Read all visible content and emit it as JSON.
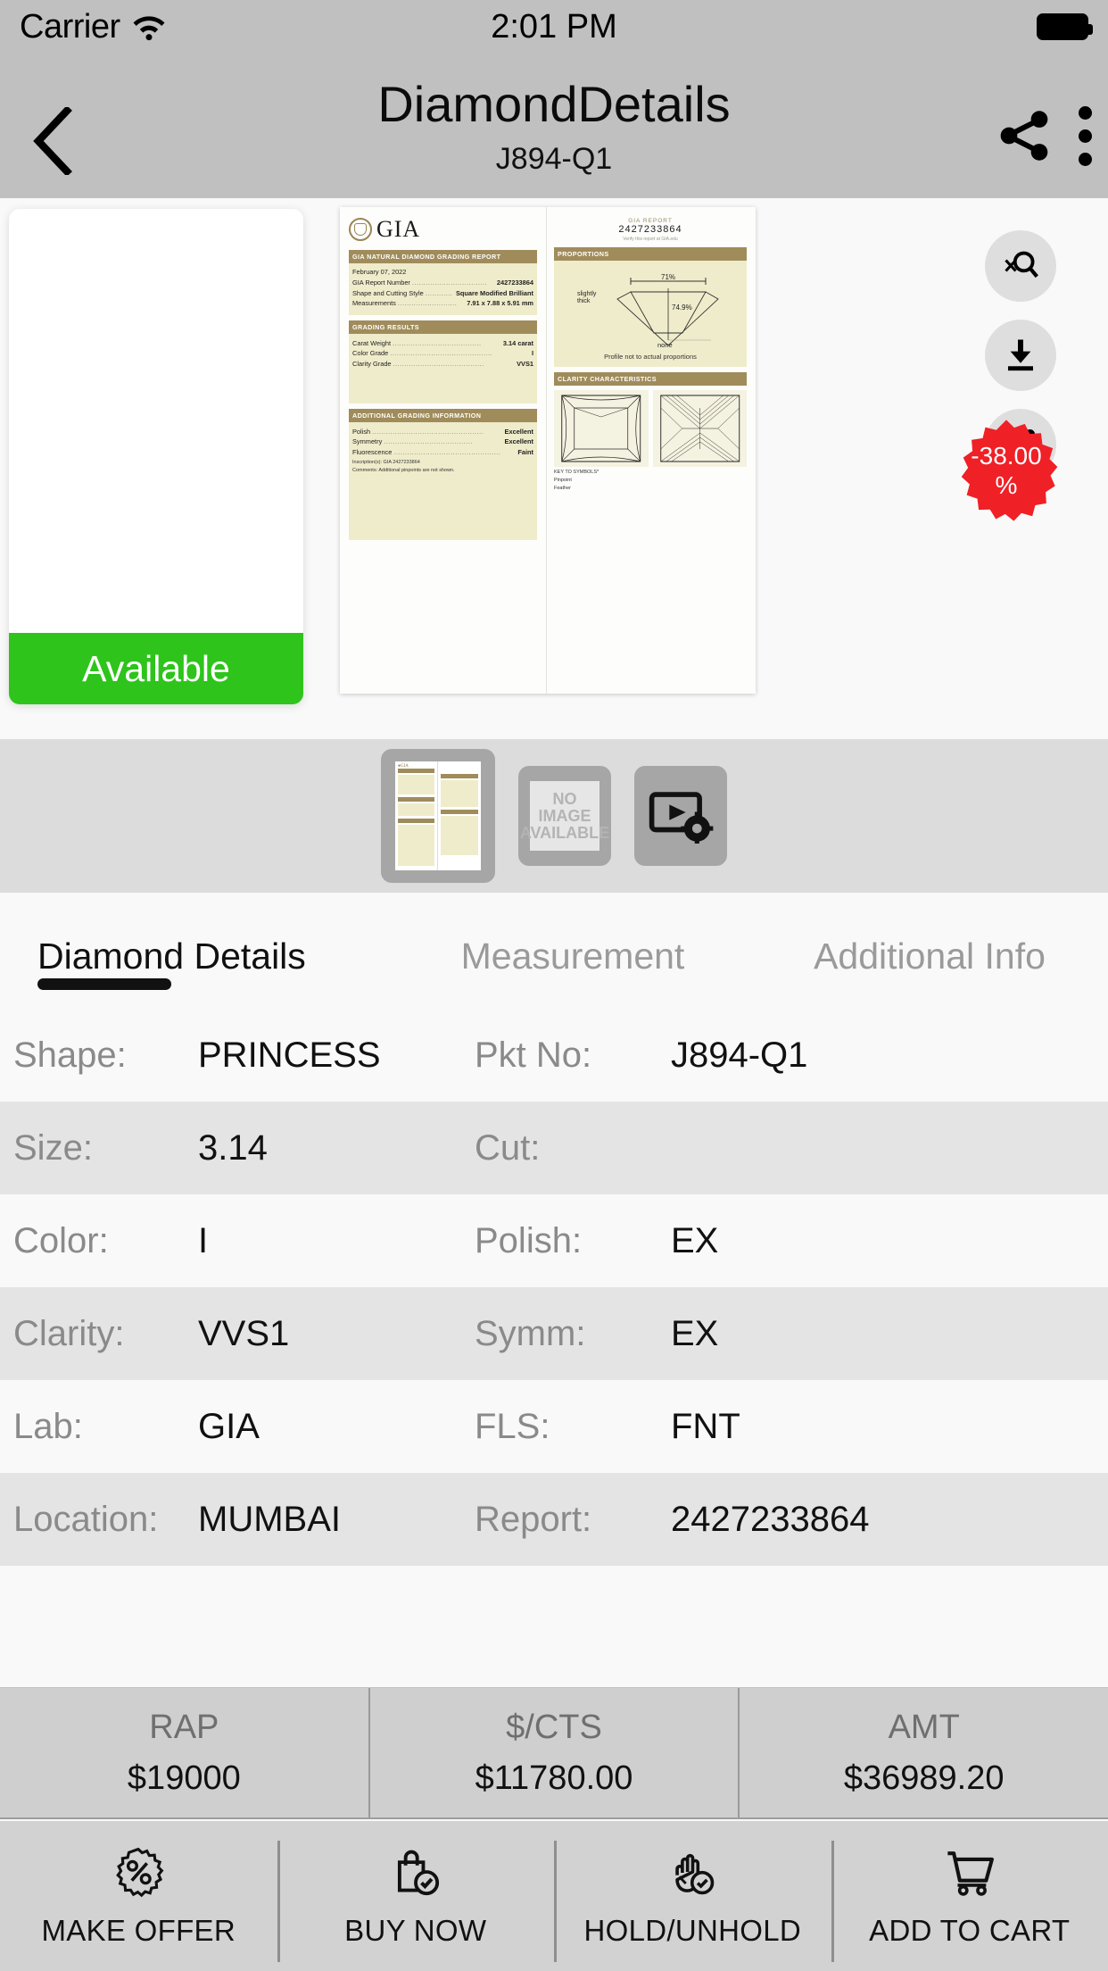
{
  "status_bar": {
    "carrier": "Carrier",
    "time": "2:01 PM",
    "wifi_icon": "wifi-icon",
    "battery_icon": "battery-full-icon"
  },
  "nav": {
    "title": "DiamondDetails",
    "subtitle": "J894-Q1",
    "back_icon": "chevron-left-icon",
    "share_icon": "share-icon",
    "more_icon": "kebab-menu-icon"
  },
  "hero": {
    "status_label": "Available",
    "status_color": "#2ec41b",
    "side_actions": [
      {
        "name": "zoom-out-icon",
        "label": "Zoom Out"
      },
      {
        "name": "download-icon",
        "label": "Download"
      },
      {
        "name": "share-icon",
        "label": "Share"
      }
    ],
    "discount": {
      "value": "-38.00",
      "unit": "%",
      "color": "#ef2026"
    }
  },
  "certificate": {
    "brand": "GIA",
    "left_page": {
      "band_report": "GIA NATURAL DIAMOND GRADING REPORT",
      "date": "February 07, 2022",
      "rows": [
        {
          "key": "GIA Report Number",
          "value": "2427233864"
        },
        {
          "key": "Shape and Cutting Style",
          "value": "Square Modified Brilliant"
        },
        {
          "key": "Measurements",
          "value": "7.91 x 7.88 x 5.91 mm"
        }
      ],
      "band_grading": "GRADING RESULTS",
      "grading_rows": [
        {
          "key": "Carat Weight",
          "value": "3.14 carat"
        },
        {
          "key": "Color Grade",
          "value": "I"
        },
        {
          "key": "Clarity Grade",
          "value": "VVS1"
        }
      ],
      "band_additional": "ADDITIONAL GRADING INFORMATION",
      "additional_rows": [
        {
          "key": "Polish",
          "value": "Excellent"
        },
        {
          "key": "Symmetry",
          "value": "Excellent"
        },
        {
          "key": "Fluorescence",
          "value": "Faint"
        }
      ],
      "inscription": "Inscription(s): GIA 2427233864",
      "comments": "Comments: Additional pinpoints are not shown."
    },
    "right_page": {
      "report_label": "GIA REPORT",
      "report_number": "2427233864",
      "verify": "Verify this report at GIA.edu",
      "band_proportions": "PROPORTIONS",
      "table_pct": "71%",
      "depth_pct": "74.9%",
      "girdle": "slightly\nthick",
      "culet": "none",
      "profile_note": "Profile not to actual proportions",
      "band_clarity": "CLARITY CHARACTERISTICS",
      "key_to_symbols": "KEY TO SYMBOLS*",
      "symbol_1": "Pinpoint",
      "symbol_2": "Feather"
    }
  },
  "thumbnails": [
    {
      "name": "thumb-certificate",
      "type": "certificate",
      "selected": true
    },
    {
      "name": "thumb-no-image",
      "type": "no-image",
      "line1": "NO",
      "line2": "IMAGE",
      "line3": "AVAILABLE",
      "selected": false
    },
    {
      "name": "thumb-video",
      "type": "video",
      "selected": false
    }
  ],
  "tabs": [
    {
      "label": "Diamond Details",
      "active": true
    },
    {
      "label": "Measurement",
      "active": false
    },
    {
      "label": "Additional Info",
      "active": false
    }
  ],
  "details": [
    {
      "k1": "Shape:",
      "v1": "PRINCESS",
      "k2": "Pkt No:",
      "v2": "J894-Q1"
    },
    {
      "k1": "Size:",
      "v1": "3.14",
      "k2": "Cut:",
      "v2": ""
    },
    {
      "k1": "Color:",
      "v1": "I",
      "k2": "Polish:",
      "v2": "EX"
    },
    {
      "k1": "Clarity:",
      "v1": "VVS1",
      "k2": "Symm:",
      "v2": "EX"
    },
    {
      "k1": "Lab:",
      "v1": "GIA",
      "k2": "FLS:",
      "v2": "FNT"
    },
    {
      "k1": "Location:",
      "v1": "MUMBAI",
      "k2": "Report:",
      "v2": "2427233864"
    }
  ],
  "price_bar": [
    {
      "label": "RAP",
      "value": "$19000"
    },
    {
      "label": "$/CTS",
      "value": "$11780.00"
    },
    {
      "label": "AMT",
      "value": "$36989.20"
    }
  ],
  "actions": [
    {
      "label": "MAKE OFFER",
      "icon": "discount-badge-icon"
    },
    {
      "label": "BUY NOW",
      "icon": "shopping-bag-check-icon"
    },
    {
      "label": "HOLD/UNHOLD",
      "icon": "hand-clock-icon"
    },
    {
      "label": "ADD TO CART",
      "icon": "shopping-cart-icon"
    }
  ]
}
